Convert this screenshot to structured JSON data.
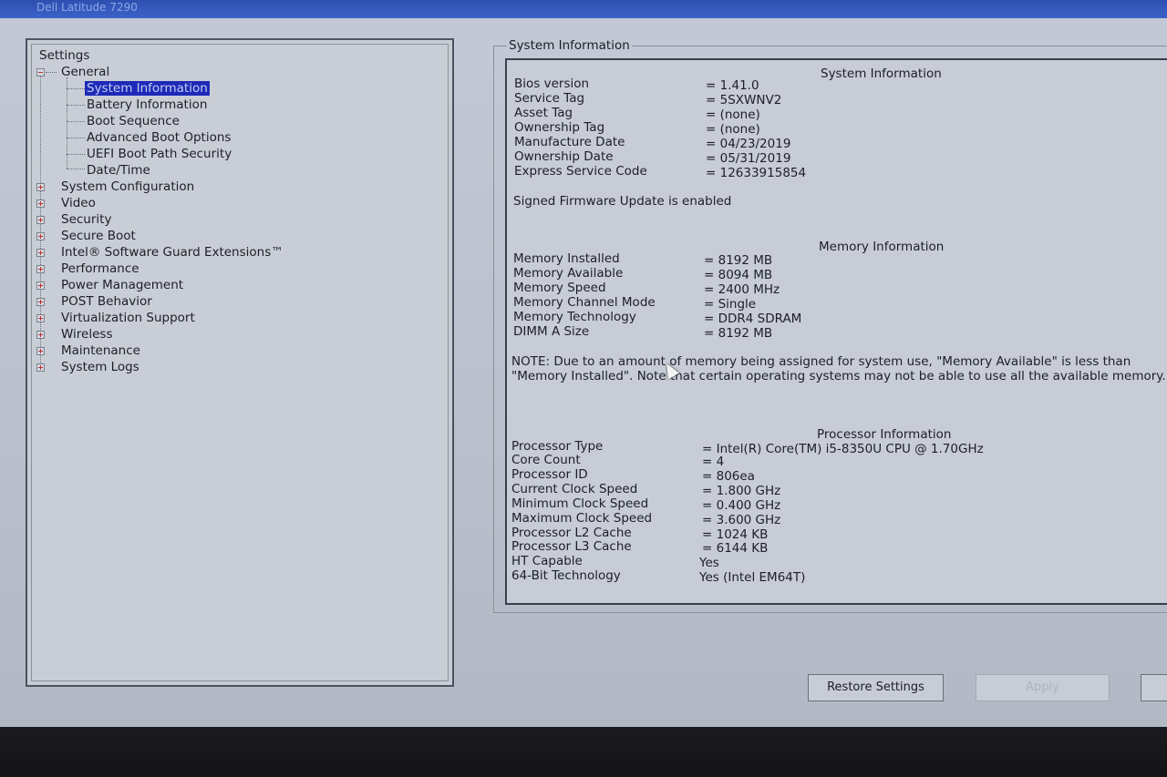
{
  "window": {
    "title": "Dell Latitude 7290"
  },
  "tree": {
    "title": "Settings",
    "general": {
      "label": "General",
      "children": [
        "System Information",
        "Battery Information",
        "Boot Sequence",
        "Advanced Boot Options",
        "UEFI Boot Path Security",
        "Date/Time"
      ],
      "selected": "System Information"
    },
    "categories": [
      "System Configuration",
      "Video",
      "Security",
      "Secure Boot",
      "Intel® Software Guard Extensions™",
      "Performance",
      "Power Management",
      "POST Behavior",
      "Virtualization Support",
      "Wireless",
      "Maintenance",
      "System Logs"
    ]
  },
  "info": {
    "group_title": "System Information",
    "system": {
      "heading": "System Information",
      "rows": [
        {
          "label": "Bios version",
          "value": "= 1.41.0"
        },
        {
          "label": "Service Tag",
          "value": "= 5SXWNV2"
        },
        {
          "label": "Asset Tag",
          "value": "= (none)"
        },
        {
          "label": "Ownership Tag",
          "value": "= (none)"
        },
        {
          "label": "Manufacture Date",
          "value": "= 04/23/2019"
        },
        {
          "label": "Ownership Date",
          "value": "= 05/31/2019"
        },
        {
          "label": "Express Service Code",
          "value": "= 12633915854"
        }
      ],
      "firmware_note": "Signed Firmware Update is enabled"
    },
    "memory": {
      "heading": "Memory Information",
      "rows": [
        {
          "label": "Memory Installed",
          "value": "= 8192 MB"
        },
        {
          "label": "Memory Available",
          "value": "= 8094 MB"
        },
        {
          "label": "Memory Speed",
          "value": "= 2400 MHz"
        },
        {
          "label": "Memory Channel Mode",
          "value": "= Single"
        },
        {
          "label": "Memory Technology",
          "value": "= DDR4 SDRAM"
        },
        {
          "label": "DIMM A Size",
          "value": "= 8192 MB"
        }
      ],
      "note": "NOTE: Due to an amount of memory being assigned for system use, \"Memory Available\" is less than \"Memory Installed\". Note that certain operating systems may not be able to use all the available memory."
    },
    "processor": {
      "heading": "Processor Information",
      "rows": [
        {
          "label": "Processor Type",
          "value": "= Intel(R) Core(TM) i5-8350U CPU @ 1.70GHz"
        },
        {
          "label": "Core Count",
          "value": "= 4"
        },
        {
          "label": "Processor ID",
          "value": "= 806ea"
        },
        {
          "label": "Current Clock Speed",
          "value": "= 1.800 GHz"
        },
        {
          "label": "Minimum Clock Speed",
          "value": "= 0.400 GHz"
        },
        {
          "label": "Maximum Clock Speed",
          "value": "= 3.600 GHz"
        },
        {
          "label": "Processor L2 Cache",
          "value": "= 1024 KB"
        },
        {
          "label": "Processor L3 Cache",
          "value": "= 6144 KB"
        },
        {
          "label": "HT Capable",
          "value": "Yes"
        },
        {
          "label": "64-Bit Technology",
          "value": "Yes (Intel EM64T)"
        }
      ]
    }
  },
  "buttons": {
    "restore": "Restore Settings",
    "apply": "Apply"
  }
}
